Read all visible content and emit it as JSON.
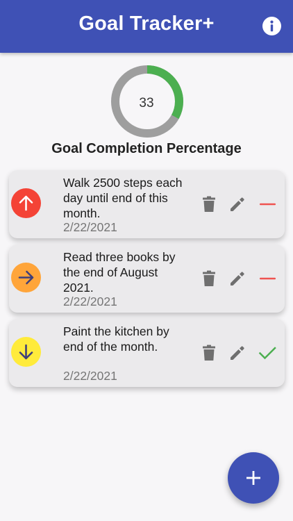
{
  "app": {
    "title": "Goal Tracker+"
  },
  "progress": {
    "value": "33",
    "percent": 33,
    "label": "Goal Completion Percentage"
  },
  "goals": [
    {
      "text": "Walk 2500 steps each day until end of this month.",
      "date": "2/22/2021",
      "priority": "high",
      "priority_icon": "arrow-up-icon",
      "priority_color": "#f44336",
      "status": "incomplete",
      "status_icon": "minus-icon"
    },
    {
      "text": "Read three books by the end of August 2021.",
      "date": "2/22/2021",
      "priority": "medium",
      "priority_icon": "arrow-right-icon",
      "priority_color": "#ffa53a",
      "status": "incomplete",
      "status_icon": "minus-icon"
    },
    {
      "text": "Paint the kitchen by end of the month.",
      "date": "2/22/2021",
      "priority": "low",
      "priority_icon": "arrow-down-icon",
      "priority_color": "#ffeb3b",
      "status": "complete",
      "status_icon": "check-icon"
    }
  ],
  "colors": {
    "primary": "#3f51b5",
    "progress_done": "#4caf50",
    "progress_remaining": "#9e9e9e",
    "incomplete": "#ef5350",
    "complete": "#4caf50"
  }
}
